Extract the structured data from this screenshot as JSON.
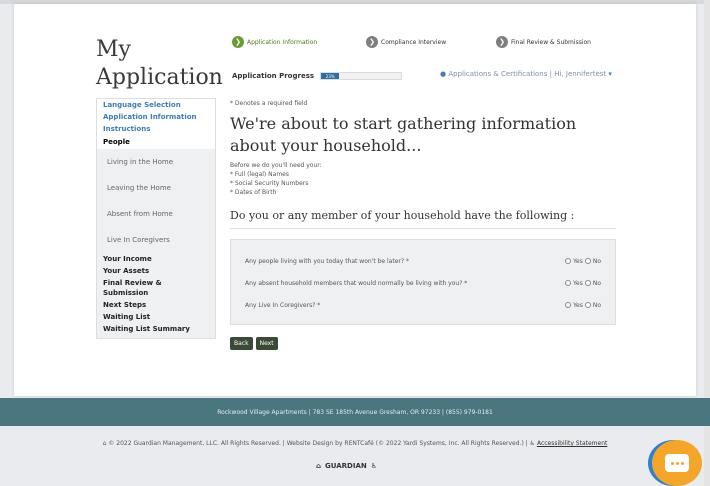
{
  "app": {
    "title_line1": "My",
    "title_line2": "Application"
  },
  "steps": [
    {
      "label": "Application Information",
      "active": true
    },
    {
      "label": "Compliance Interview",
      "active": false
    },
    {
      "label": "Final Review & Submission",
      "active": false
    }
  ],
  "progress": {
    "label": "Application Progress",
    "value_text": "23%",
    "fraction": 0.23
  },
  "user": {
    "apps_label": "Applications & Certifications",
    "greeting": "Hi, Jennifertest"
  },
  "sidebar": {
    "items": [
      {
        "label": "Language Selection",
        "kind": "link"
      },
      {
        "label": "Application Information",
        "kind": "link"
      },
      {
        "label": "Instructions",
        "kind": "link"
      },
      {
        "label": "People",
        "kind": "current"
      },
      {
        "label": "Living in the Home",
        "kind": "sub"
      },
      {
        "label": "Leaving the Home",
        "kind": "sub"
      },
      {
        "label": "Absent from Home",
        "kind": "sub"
      },
      {
        "label": "Live In Coregivers",
        "kind": "sub"
      },
      {
        "label": "Your Income",
        "kind": "bold"
      },
      {
        "label": "Your Assets",
        "kind": "bold"
      },
      {
        "label": "Final Review & Submission",
        "kind": "bold"
      },
      {
        "label": "Next Steps",
        "kind": "bold"
      },
      {
        "label": "Waiting List",
        "kind": "bold"
      },
      {
        "label": "Waiting List Summary",
        "kind": "bold"
      }
    ]
  },
  "main": {
    "required_note": "* Denotes a required field",
    "heading": "We're about to start gathering information about your household...",
    "before_intro": "Before we do you'll need your:",
    "needs": [
      "* Full (legal) Names",
      "* Social Security Numbers",
      "* Dates of Birth"
    ],
    "subheading": "Do you or any member of your household have the following :",
    "questions": [
      {
        "text": "Any people living with you today that won't be later? *",
        "yes": "Yes",
        "no": "No"
      },
      {
        "text": "Any absent household members that would normally be living with you? *",
        "yes": "Yes",
        "no": "No"
      },
      {
        "text": "Any Live In Coregivers? *",
        "yes": "Yes",
        "no": "No"
      }
    ],
    "back_label": "Back",
    "next_label": "Next"
  },
  "footer": {
    "address": "Rockwood Village Apartments  |  783 SE 185th Avenue  Gresham, OR 97233  |  (855) 979-0181",
    "copyright": "© 2022 Guardian Management, LLC. All Rights Reserved. | Website Design by RENTCafé (© 2022 Yardi Systems, Inc. All Rights Reserved.) |",
    "accessibility": "Accessibility Statement",
    "logo_text": "GUARDIAN"
  },
  "colors": {
    "accent_green": "#6a9a34",
    "footer_teal": "#49767f",
    "link_blue": "#3b7db5",
    "chat_orange": "#f4a62a"
  }
}
